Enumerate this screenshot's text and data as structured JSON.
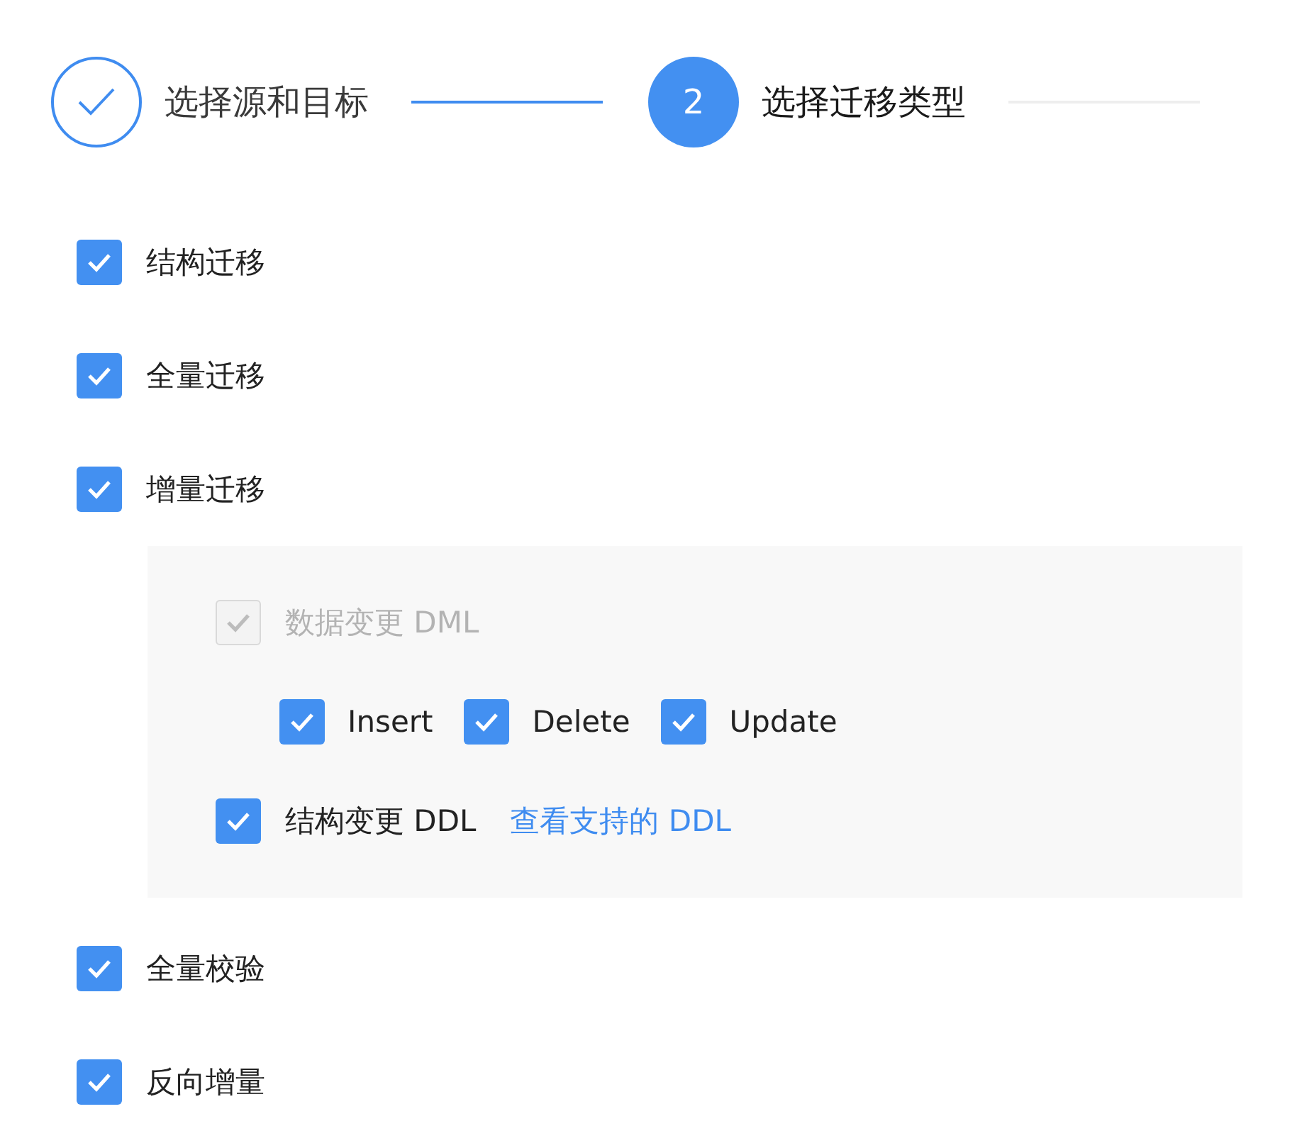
{
  "steps": [
    {
      "label": "选择源和目标",
      "completed": true,
      "selected": false
    },
    {
      "number": "2",
      "label": "选择迁移类型",
      "completed": false,
      "selected": true
    }
  ],
  "options": [
    {
      "label": "结构迁移",
      "checked": true
    },
    {
      "label": "全量迁移",
      "checked": true
    },
    {
      "label": "增量迁移",
      "checked": true,
      "details": {
        "dml": {
          "label": "数据变更 DML",
          "checked": true,
          "disabled": true,
          "items": [
            {
              "label": "Insert",
              "checked": true
            },
            {
              "label": "Delete",
              "checked": true
            },
            {
              "label": "Update",
              "checked": true
            }
          ]
        },
        "ddl": {
          "label": "结构变更 DDL",
          "checked": true,
          "link": "查看支持的 DDL"
        }
      }
    },
    {
      "label": "全量校验",
      "checked": true
    },
    {
      "label": "反向增量",
      "checked": true
    }
  ]
}
